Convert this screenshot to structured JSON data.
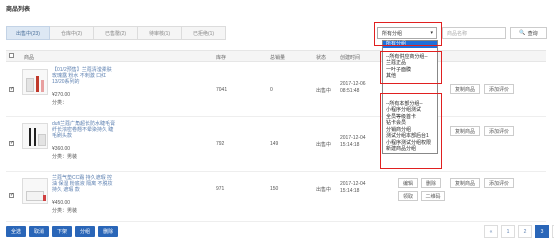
{
  "page": {
    "title": "商品列表"
  },
  "tabs": [
    {
      "label": "出售中(23)",
      "active": true
    },
    {
      "label": "仓库中(2)",
      "active": false
    },
    {
      "label": "已售罄(2)",
      "active": false
    },
    {
      "label": "待审核(1)",
      "active": false
    },
    {
      "label": "已拒绝(1)",
      "active": false
    }
  ],
  "filter": {
    "category_selected": "所有分组",
    "search_placeholder": "商品名称",
    "search_button": "查询"
  },
  "table": {
    "headers": [
      "商品",
      "库存",
      "总销量",
      "状态",
      "创建时间"
    ],
    "rows": [
      {
        "name": "【01/2预售】兰蔻清滢柔肤玫瑰露 粉水 不刺激 口红 13/20系列的",
        "price": "¥270.00",
        "category": "分类：",
        "stock": "7041",
        "sales": "0",
        "status": "出售中",
        "created": "2017-12-06 08:51:48"
      },
      {
        "name": "dufi兰蔻广角超长防水睫毛膏 纤长浓密卷翘不晕染持久 睫毛刷头款",
        "price": "¥360.00",
        "category": "分类：男装",
        "stock": "792",
        "sales": "149",
        "status": "出售中",
        "created": "2017-12-04 15:14:18"
      },
      {
        "name": "兰蔻气垫CC霜 持久遮瑕 控油 保湿 粉底液 隔离 不脱妆 持久 遮瑕 款",
        "price": "¥450.00",
        "category": "分类：男装",
        "stock": "971",
        "sales": "150",
        "status": "出售中",
        "created": "2017-12-04 15:14:18"
      }
    ]
  },
  "actions": {
    "edit": "编辑",
    "delete": "删除",
    "copy": "复制商品",
    "add_review": "添加评价",
    "collect": "领取",
    "qrcode": "二维码"
  },
  "dropdown": {
    "items": [
      {
        "label": "所有分组",
        "selected": true
      },
      {
        "label": "--所有供应商分组--",
        "selected": false
      },
      {
        "label": "兰蔻正品",
        "selected": false
      },
      {
        "label": "一叶子面膜",
        "selected": false
      },
      {
        "label": "其他",
        "selected": false
      },
      {
        "label": "--所有本部分组--",
        "selected": false
      },
      {
        "label": "小程序分组测试",
        "selected": false
      },
      {
        "label": "全员等级首卡",
        "selected": false
      },
      {
        "label": "钻卡会员",
        "selected": false
      },
      {
        "label": "分销商分组",
        "selected": false
      },
      {
        "label": "测试分组本部后台1",
        "selected": false
      },
      {
        "label": "小程序测试分组权限",
        "selected": false
      },
      {
        "label": "新建商品分组",
        "selected": false
      }
    ]
  },
  "bottom_actions": [
    "全选",
    "取消",
    "下架",
    "分组",
    "删除"
  ],
  "pagination": {
    "prev": "«",
    "pages": [
      "1",
      "2",
      "3"
    ],
    "current": "3",
    "next": "»"
  },
  "colors": {
    "primary": "#2a66b8",
    "highlight": "#e02020",
    "selected": "#1e6fd9"
  }
}
